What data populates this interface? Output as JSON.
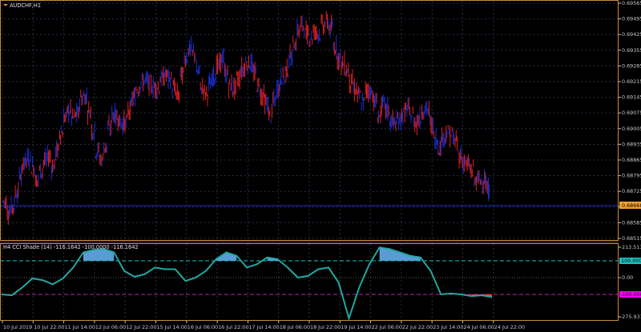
{
  "window": {
    "symbol_title": "AUDCHF,H1",
    "indicator_title": "H4 CCI Shade (14) -116.1642 -100.0000 -116.1642"
  },
  "price_axis": {
    "ticks": [
      "0.69565",
      "0.69495",
      "0.69425",
      "0.69355",
      "0.69285",
      "0.69215",
      "0.69145",
      "0.69075",
      "0.69005",
      "0.68935",
      "0.68865",
      "0.68795",
      "0.68725",
      "0.68655",
      "0.68585",
      "0.68515"
    ],
    "current_price": "0.68668"
  },
  "cci_axis": {
    "ticks": [
      "213.5132",
      "100.0000",
      "0.00",
      "-100.0000",
      "-275.9313"
    ]
  },
  "time_axis": {
    "labels": [
      "10 Jul 2019",
      "10 Jul 22:00",
      "11 Jul 14:00",
      "12 Jul 06:00",
      "12 Jul 22:00",
      "15 Jul 14:00",
      "16 Jul 06:00",
      "16 Jul 22:00",
      "17 Jul 14:00",
      "18 Jul 06:00",
      "18 Jul 22:00",
      "19 Jul 14:00",
      "22 Jul 06:00",
      "22 Jul 22:00",
      "23 Jul 14:00",
      "24 Jul 06:00",
      "24 Jul 22:00"
    ]
  },
  "colors": {
    "background": "#000000",
    "frame": "#c88c3c",
    "grid": "#2a2f4a",
    "bull_bar": "#1a2fd0",
    "bear_bar": "#e02020",
    "cci_line": "#22a7a0",
    "cci_fill_high": "#5b9bd5",
    "cci_fill_low": "#ff4500",
    "level_100": "#18c0c0",
    "level_m100": "#c020a0",
    "current_price_label_bg": "#f0a030",
    "m100_label_bg": "#ff00ff",
    "p100_label_bg": "#20c0c0"
  },
  "chart_data": [
    {
      "type": "line",
      "name": "AUDCHF,H1",
      "x_label_range": [
        "10 Jul 2019",
        "24 Jul 22:00"
      ],
      "ylim": [
        0.68515,
        0.69565
      ],
      "x": [
        0,
        1,
        2,
        3,
        4,
        5,
        6,
        7,
        8,
        9,
        10,
        11,
        12,
        13,
        14,
        15,
        16,
        17,
        18,
        19,
        20,
        21,
        22,
        23,
        24,
        25,
        26,
        27,
        28,
        29,
        30,
        31,
        32,
        33,
        34,
        35,
        36,
        37,
        38,
        39,
        40,
        41,
        42,
        43,
        44,
        45,
        46,
        47,
        48,
        49,
        50,
        51,
        52,
        53,
        54,
        55,
        56,
        57,
        58,
        59,
        60,
        61,
        62,
        63,
        64,
        65,
        66,
        67,
        68,
        69,
        70,
        71,
        72,
        73,
        74,
        75,
        76,
        77,
        78,
        79,
        80,
        81,
        82,
        83,
        84,
        85,
        86,
        87,
        88,
        89,
        90,
        91,
        92,
        93,
        94,
        95,
        96,
        97,
        98,
        99,
        100,
        101,
        102,
        103,
        104,
        105,
        106,
        107,
        108,
        109,
        110,
        111,
        112,
        113,
        114,
        115,
        116,
        117,
        118,
        119,
        120
      ],
      "values": [
        0.6868,
        0.6862,
        0.687,
        0.688,
        0.6889,
        0.6885,
        0.6877,
        0.6884,
        0.6889,
        0.6883,
        0.6895,
        0.6905,
        0.6909,
        0.6903,
        0.6914,
        0.6915,
        0.6904,
        0.6891,
        0.6886,
        0.6898,
        0.6907,
        0.6905,
        0.6901,
        0.6909,
        0.6916,
        0.6921,
        0.6922,
        0.692,
        0.6918,
        0.6923,
        0.6925,
        0.6919,
        0.6915,
        0.693,
        0.6936,
        0.6934,
        0.692,
        0.6916,
        0.6921,
        0.6927,
        0.6932,
        0.6923,
        0.6917,
        0.6923,
        0.6928,
        0.6931,
        0.6925,
        0.6918,
        0.6913,
        0.6906,
        0.6916,
        0.6923,
        0.6927,
        0.6935,
        0.6944,
        0.6947,
        0.694,
        0.6944,
        0.6943,
        0.6949,
        0.6946,
        0.6935,
        0.693,
        0.6927,
        0.692,
        0.6916,
        0.6912,
        0.692,
        0.6914,
        0.6906,
        0.6913,
        0.6904,
        0.6903,
        0.6905,
        0.691,
        0.6906,
        0.6902,
        0.6909,
        0.6909,
        0.6898,
        0.6892,
        0.6898,
        0.6899,
        0.6895,
        0.6887,
        0.6885,
        0.6882,
        0.6876,
        0.6879,
        0.6873,
        0.6868,
        0.6871,
        0.6867,
        0.6866,
        0.6866,
        0.6866,
        0.6866,
        0.6866,
        0.6866,
        0.6866,
        0.6866,
        0.6866,
        0.6866,
        0.6866,
        0.6866,
        0.6866,
        0.6866,
        0.6866,
        0.6866,
        0.6866,
        0.6866,
        0.6866,
        0.6866,
        0.6866,
        0.6866,
        0.6866,
        0.6866,
        0.6866,
        0.6866,
        0.6866,
        0.6866
      ]
    },
    {
      "type": "area",
      "name": "H4 CCI Shade (14)",
      "ylim": [
        -275.9313,
        213.5132
      ],
      "levels": [
        100,
        0,
        -100
      ],
      "x": [
        0,
        5,
        10,
        15,
        20,
        25,
        30,
        35,
        40,
        45,
        50,
        55,
        60,
        65,
        70,
        75,
        80,
        85,
        90,
        95,
        100,
        105,
        110,
        115,
        120,
        125,
        130,
        135,
        140,
        145,
        150,
        155,
        160,
        165,
        170,
        175,
        180,
        185,
        190,
        195,
        200,
        205,
        210,
        215,
        220,
        225,
        230,
        235,
        240
      ],
      "values": [
        -100,
        -105,
        -60,
        -5,
        -15,
        -40,
        -5,
        60,
        150,
        165,
        170,
        150,
        40,
        5,
        20,
        60,
        50,
        50,
        -20,
        0,
        40,
        110,
        150,
        130,
        60,
        80,
        120,
        110,
        60,
        0,
        10,
        50,
        60,
        -30,
        -260,
        -60,
        80,
        180,
        170,
        150,
        130,
        120,
        40,
        -100,
        -95,
        -100,
        -110,
        -105,
        -116
      ]
    }
  ]
}
